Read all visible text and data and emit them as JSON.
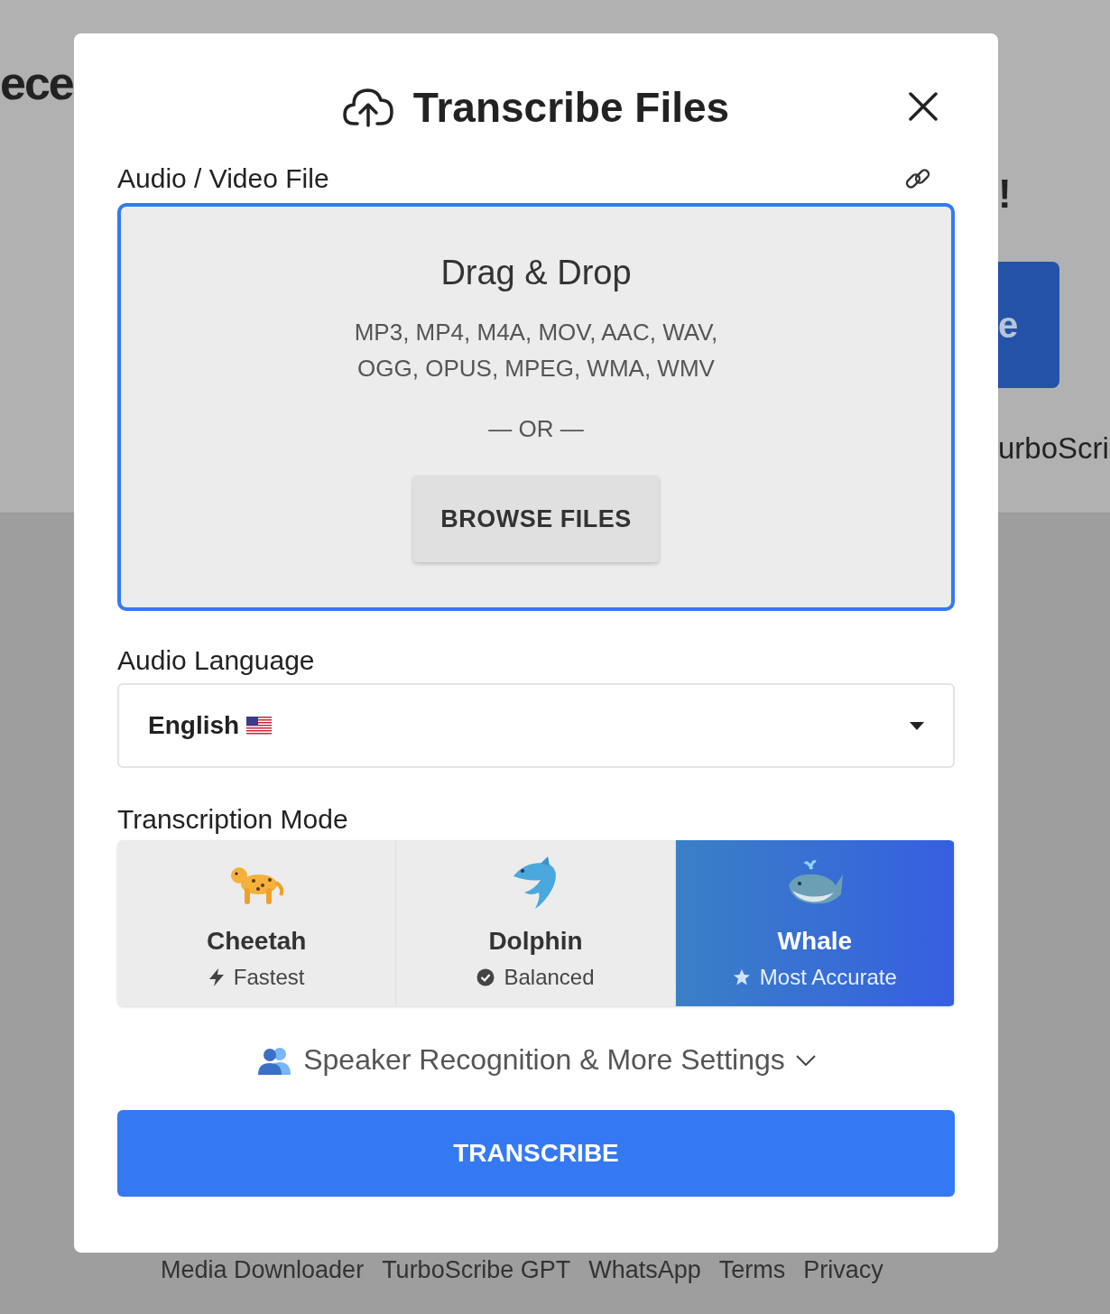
{
  "background": {
    "heading": "ece",
    "exclamation": "!",
    "button_label": "e",
    "brand_text": "urboScri",
    "footer_links": [
      "Media Downloader",
      "TurboScribe GPT",
      "WhatsApp",
      "Terms",
      "Privacy"
    ]
  },
  "dialog": {
    "title": "Transcribe Files",
    "file_label": "Audio / Video File",
    "dropzone": {
      "heading": "Drag & Drop",
      "formats": [
        "MP3, MP4, M4A, MOV, AAC, WAV,",
        "OGG, OPUS, MPEG, WMA, WMV"
      ],
      "separator": "— OR —",
      "browse_button": "BROWSE FILES"
    },
    "language": {
      "label": "Audio Language",
      "value": "English"
    },
    "mode": {
      "label": "Transcription Mode",
      "options": [
        {
          "kind": "cheetah",
          "name": "Cheetah",
          "note": "Fastest",
          "selected": false
        },
        {
          "kind": "dolphin",
          "name": "Dolphin",
          "note": "Balanced",
          "selected": false
        },
        {
          "kind": "whale",
          "name": "Whale",
          "note": "Most Accurate",
          "selected": true
        }
      ]
    },
    "settings_toggle": {
      "label": "Speaker Recognition & More Settings",
      "expanded": false
    },
    "submit": "TRANSCRIBE"
  }
}
